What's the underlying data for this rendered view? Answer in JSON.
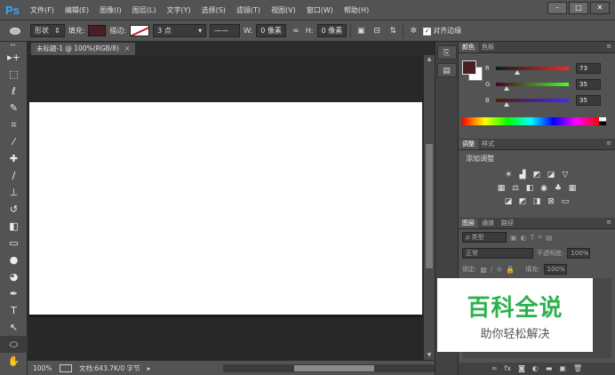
{
  "app": {
    "logo": "Ps"
  },
  "menu": [
    "文件(F)",
    "编辑(E)",
    "图像(I)",
    "图层(L)",
    "文字(Y)",
    "选择(S)",
    "滤镜(T)",
    "视图(V)",
    "窗口(W)",
    "帮助(H)"
  ],
  "window_controls": {
    "minimize": "–",
    "restore": "□",
    "close": "✕"
  },
  "options": {
    "mode": "形状",
    "fill_label": "填充:",
    "stroke_label": "描边:",
    "stroke_width": "3 点",
    "w_label": "W:",
    "w_value": "0 像素",
    "link_icon": "∞",
    "h_label": "H:",
    "h_value": "0 像素",
    "align_edges_label": "对齐边缘",
    "fill_color": "#4a1f22"
  },
  "document": {
    "tab_title": "未标题-1 @ 100%(RGB/8)",
    "zoom": "100%",
    "doc_info": "文档:643.7K/0 字节"
  },
  "tools": [
    "move-icon",
    "marquee-icon",
    "lasso-icon",
    "quick-select-icon",
    "crop-icon",
    "eyedropper-icon",
    "healing-icon",
    "brush-icon",
    "stamp-icon",
    "history-brush-icon",
    "eraser-icon",
    "gradient-icon",
    "blur-icon",
    "dodge-icon",
    "pen-icon",
    "type-icon",
    "path-select-icon",
    "ellipse-icon",
    "hand-icon"
  ],
  "tool_glyphs": [
    "▸+",
    "⬚",
    "ℓ",
    "✎",
    "⌗",
    "⁄",
    "✚",
    "∕",
    "⊥",
    "↺",
    "◧",
    "▭",
    "●",
    "◕",
    "✒",
    "T",
    "↖",
    "⬭",
    "✋"
  ],
  "color_panel": {
    "tabs": [
      "颜色",
      "色板"
    ],
    "r_label": "R",
    "r_value": "73",
    "g_label": "G",
    "g_value": "35",
    "b_label": "B",
    "b_value": "35",
    "fg_color": "#4a1f22"
  },
  "adjust_panel": {
    "tabs": [
      "调整",
      "样式"
    ],
    "title": "添加调整"
  },
  "layers_panel": {
    "tabs": [
      "图层",
      "通道",
      "路径"
    ],
    "filter": "ρ 类型",
    "blend_mode": "正常",
    "opacity_label": "不透明度:",
    "opacity_value": "100%",
    "lock_label": "锁定:",
    "fill_label": "填充:",
    "fill_value": "100%"
  },
  "watermark": {
    "title": "百科全说",
    "subtitle": "助你轻松解决"
  }
}
